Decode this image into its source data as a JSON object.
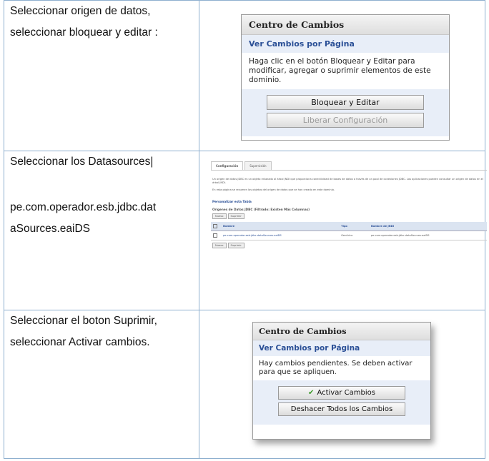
{
  "rows": [
    {
      "instruction_lines": [
        "Seleccionar origen de datos,",
        "seleccionar bloquear y editar :"
      ]
    },
    {
      "instruction_lines": [
        "Seleccionar los Datasources|",
        "pe.com.operador.esb.jdbc.dat",
        "aSources.eaiDS"
      ]
    },
    {
      "instruction_lines": [
        "Seleccionar el boton Suprimir,",
        "seleccionar Activar cambios."
      ]
    }
  ],
  "panel1": {
    "title": "Centro de Cambios",
    "subtitle": "Ver Cambios por Página",
    "body": "Haga clic en el botón Bloquear y Editar para modificar, agregar o suprimir elementos de este dominio.",
    "button_lock": "Bloquear y Editar",
    "button_release": "Liberar Configuración"
  },
  "mini": {
    "tab_config": "Configuración",
    "tab_monitor": "Supervisión",
    "para1": "Un origen de datos JDBC es un objeto enlazado al árbol JNDI que proporciona conectividad de bases de datos a través de un pool de conexiones JDBC. Las aplicaciones pueden consultar un origen de datos en el árbol JNDI.",
    "para2": "En esta página se resumen los objetos del origen de datos que se han creado en este dominio.",
    "link": "Personalizar esta Tabla",
    "caption": "Orígenes de Datos JDBC (Filtrado: Existen Más Columnas)",
    "btn_new": "Nuevo",
    "btn_delete": "Suprimir",
    "col_name": "Nombre",
    "col_type": "Tipo",
    "col_jndi": "Nombre de JNDI",
    "row_name": "pe.com.operador.esb.jdbc.dataSources.eaiDS",
    "row_type": "Genérico",
    "row_jndi": "pe.com.operador.esb.jdbc.dataSources.eaiDS"
  },
  "panel3": {
    "title": "Centro de Cambios",
    "subtitle": "Ver Cambios por Página",
    "body": "Hay cambios pendientes. Se deben activar para que se apliquen.",
    "button_activate": "Activar Cambios",
    "button_undo": "Deshacer Todos los Cambios",
    "check_icon": "check-icon"
  }
}
